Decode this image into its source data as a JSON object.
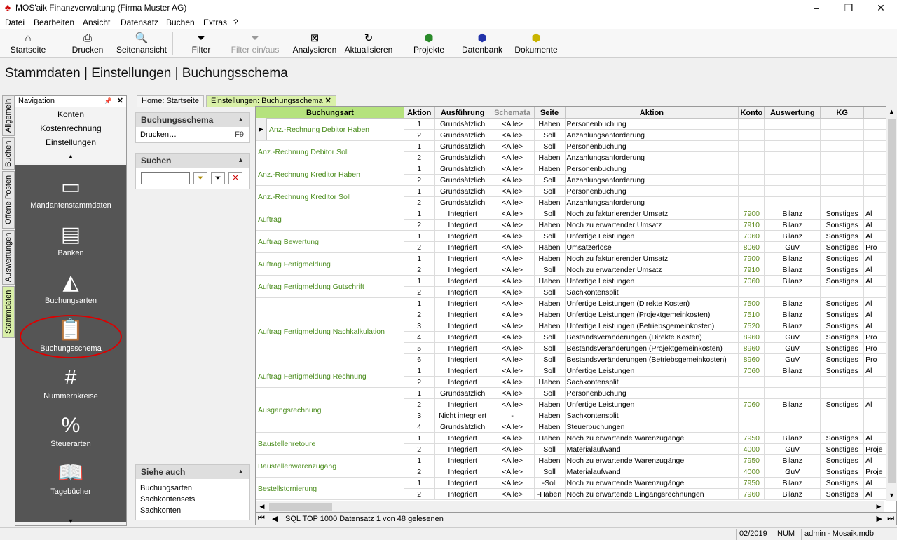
{
  "window": {
    "title": "MOS'aik Finanzverwaltung (Firma Muster AG)",
    "min": "–",
    "max": "❐",
    "close": "✕"
  },
  "menu": [
    "Datei",
    "Bearbeiten",
    "Ansicht",
    "Datensatz",
    "Buchen",
    "Extras",
    "?"
  ],
  "toolbar": {
    "startseite": "Startseite",
    "drucken": "Drucken",
    "seitenansicht": "Seitenansicht",
    "filter": "Filter",
    "filter_einaus": "Filter ein/aus",
    "analysieren": "Analysieren",
    "aktualisieren": "Aktualisieren",
    "projekte": "Projekte",
    "datenbank": "Datenbank",
    "dokumente": "Dokumente"
  },
  "page_title": "Stammdaten | Einstellungen | Buchungsschema",
  "vtabs": [
    "Allgemein",
    "Buchen",
    "Offene Posten",
    "Auswertungen",
    "Stammdaten"
  ],
  "navigation": {
    "title": "Navigation",
    "pin": "📌",
    "close": "✕",
    "buttons": [
      "Konten",
      "Kostenrechnung",
      "Einstellungen"
    ],
    "up": "▲",
    "down": "▼",
    "items": [
      "Mandantenstammdaten",
      "Banken",
      "Buchungsarten",
      "Buchungsschema",
      "Nummernkreise",
      "Steuerarten",
      "Tagebücher"
    ]
  },
  "panels": {
    "buchungsschema": {
      "title": "Buchungsschema",
      "item": "Drucken…",
      "shortcut": "F9"
    },
    "suchen": {
      "title": "Suchen",
      "value": ""
    },
    "siehe_auch": {
      "title": "Siehe auch",
      "items": [
        "Buchungsarten",
        "Sachkontensets",
        "Sachkonten"
      ]
    }
  },
  "tabs": {
    "home": "Home: Startseite",
    "einstellungen": "Einstellungen: Buchungsschema",
    "close": "✕"
  },
  "columns": [
    "Buchungsart",
    "Aktion",
    "Ausführung",
    "Schemata",
    "Seite",
    "Aktion",
    "Konto",
    "Auswertung",
    "KG",
    ""
  ],
  "groups": [
    {
      "name": "Anz.-Rechnung Debitor Haben",
      "rows": [
        [
          "1",
          "Grundsätzlich",
          "<Alle>",
          "Haben",
          "Personenbuchung",
          "",
          "",
          "",
          ""
        ],
        [
          "2",
          "Grundsätzlich",
          "<Alle>",
          "Soll",
          "Anzahlungsanforderung",
          "",
          "",
          "",
          ""
        ]
      ]
    },
    {
      "name": "Anz.-Rechnung Debitor Soll",
      "rows": [
        [
          "1",
          "Grundsätzlich",
          "<Alle>",
          "Soll",
          "Personenbuchung",
          "",
          "",
          "",
          ""
        ],
        [
          "2",
          "Grundsätzlich",
          "<Alle>",
          "Haben",
          "Anzahlungsanforderung",
          "",
          "",
          "",
          ""
        ]
      ]
    },
    {
      "name": "Anz.-Rechnung Kreditor Haben",
      "rows": [
        [
          "1",
          "Grundsätzlich",
          "<Alle>",
          "Haben",
          "Personenbuchung",
          "",
          "",
          "",
          ""
        ],
        [
          "2",
          "Grundsätzlich",
          "<Alle>",
          "Soll",
          "Anzahlungsanforderung",
          "",
          "",
          "",
          ""
        ]
      ]
    },
    {
      "name": "Anz.-Rechnung Kreditor Soll",
      "rows": [
        [
          "1",
          "Grundsätzlich",
          "<Alle>",
          "Soll",
          "Personenbuchung",
          "",
          "",
          "",
          ""
        ],
        [
          "2",
          "Grundsätzlich",
          "<Alle>",
          "Haben",
          "Anzahlungsanforderung",
          "",
          "",
          "",
          ""
        ]
      ]
    },
    {
      "name": "Auftrag",
      "rows": [
        [
          "1",
          "Integriert",
          "<Alle>",
          "Soll",
          "Noch zu fakturierender Umsatz",
          "7900",
          "Bilanz",
          "Sonstiges",
          "Al"
        ],
        [
          "2",
          "Integriert",
          "<Alle>",
          "Haben",
          "Noch zu erwartender Umsatz",
          "7910",
          "Bilanz",
          "Sonstiges",
          "Al"
        ]
      ]
    },
    {
      "name": "Auftrag Bewertung",
      "rows": [
        [
          "1",
          "Integriert",
          "<Alle>",
          "Soll",
          "Unfertige Leistungen",
          "7060",
          "Bilanz",
          "Sonstiges",
          "Al"
        ],
        [
          "2",
          "Integriert",
          "<Alle>",
          "Haben",
          "Umsatzerlöse",
          "8060",
          "GuV",
          "Sonstiges",
          "Pro"
        ]
      ]
    },
    {
      "name": "Auftrag Fertigmeldung",
      "rows": [
        [
          "1",
          "Integriert",
          "<Alle>",
          "Haben",
          "Noch zu fakturierender Umsatz",
          "7900",
          "Bilanz",
          "Sonstiges",
          "Al"
        ],
        [
          "2",
          "Integriert",
          "<Alle>",
          "Soll",
          "Noch zu erwartender Umsatz",
          "7910",
          "Bilanz",
          "Sonstiges",
          "Al"
        ]
      ]
    },
    {
      "name": "Auftrag Fertigmeldung Gutschrift",
      "rows": [
        [
          "1",
          "Integriert",
          "<Alle>",
          "Haben",
          "Unfertige Leistungen",
          "7060",
          "Bilanz",
          "Sonstiges",
          "Al"
        ],
        [
          "2",
          "Integriert",
          "<Alle>",
          "Soll",
          "Sachkontensplit",
          "",
          "",
          "",
          ""
        ]
      ]
    },
    {
      "name": "Auftrag Fertigmeldung Nachkalkulation",
      "rows": [
        [
          "1",
          "Integriert",
          "<Alle>",
          "Haben",
          "Unfertige Leistungen (Direkte Kosten)",
          "7500",
          "Bilanz",
          "Sonstiges",
          "Al"
        ],
        [
          "2",
          "Integriert",
          "<Alle>",
          "Haben",
          "Unfertige Leistungen (Projektgemeinkosten)",
          "7510",
          "Bilanz",
          "Sonstiges",
          "Al"
        ],
        [
          "3",
          "Integriert",
          "<Alle>",
          "Haben",
          "Unfertige Leistungen (Betriebsgemeinkosten)",
          "7520",
          "Bilanz",
          "Sonstiges",
          "Al"
        ],
        [
          "4",
          "Integriert",
          "<Alle>",
          "Soll",
          "Bestandsveränderungen (Direkte Kosten)",
          "8960",
          "GuV",
          "Sonstiges",
          "Pro"
        ],
        [
          "5",
          "Integriert",
          "<Alle>",
          "Soll",
          "Bestandsveränderungen (Projektgemeinkosten)",
          "8960",
          "GuV",
          "Sonstiges",
          "Pro"
        ],
        [
          "6",
          "Integriert",
          "<Alle>",
          "Soll",
          "Bestandsveränderungen (Betriebsgemeinkosten)",
          "8960",
          "GuV",
          "Sonstiges",
          "Pro"
        ]
      ]
    },
    {
      "name": "Auftrag Fertigmeldung Rechnung",
      "rows": [
        [
          "1",
          "Integriert",
          "<Alle>",
          "Soll",
          "Unfertige Leistungen",
          "7060",
          "Bilanz",
          "Sonstiges",
          "Al"
        ],
        [
          "2",
          "Integriert",
          "<Alle>",
          "Haben",
          "Sachkontensplit",
          "",
          "",
          "",
          ""
        ]
      ]
    },
    {
      "name": "Ausgangsrechnung",
      "rows": [
        [
          "1",
          "Grundsätzlich",
          "<Alle>",
          "Soll",
          "Personenbuchung",
          "",
          "",
          "",
          ""
        ],
        [
          "2",
          "Integriert",
          "<Alle>",
          "Haben",
          "Unfertige Leistungen",
          "7060",
          "Bilanz",
          "Sonstiges",
          "Al"
        ],
        [
          "3",
          "Nicht integriert",
          "-",
          "Haben",
          "Sachkontensplit",
          "",
          "",
          "",
          ""
        ],
        [
          "4",
          "Grundsätzlich",
          "<Alle>",
          "Haben",
          "Steuerbuchungen",
          "",
          "",
          "",
          ""
        ]
      ]
    },
    {
      "name": "Baustellenretoure",
      "rows": [
        [
          "1",
          "Integriert",
          "<Alle>",
          "Haben",
          "Noch zu erwartende Warenzugänge",
          "7950",
          "Bilanz",
          "Sonstiges",
          "Al"
        ],
        [
          "2",
          "Integriert",
          "<Alle>",
          "Soll",
          "Materialaufwand",
          "4000",
          "GuV",
          "Sonstiges",
          "Proje"
        ]
      ]
    },
    {
      "name": "Baustellenwarenzugang",
      "rows": [
        [
          "1",
          "Integriert",
          "<Alle>",
          "Haben",
          "Noch zu erwartende Warenzugänge",
          "7950",
          "Bilanz",
          "Sonstiges",
          "Al"
        ],
        [
          "2",
          "Integriert",
          "<Alle>",
          "Soll",
          "Materialaufwand",
          "4000",
          "GuV",
          "Sonstiges",
          "Proje"
        ]
      ]
    },
    {
      "name": "Bestellstornierung",
      "rows": [
        [
          "1",
          "Integriert",
          "<Alle>",
          "-Soll",
          "Noch zu erwartende Warenzugänge",
          "7950",
          "Bilanz",
          "Sonstiges",
          "Al"
        ],
        [
          "2",
          "Integriert",
          "<Alle>",
          "-Haben",
          "Noch zu erwartende Eingangsrechnungen",
          "7960",
          "Bilanz",
          "Sonstiges",
          "Al"
        ]
      ]
    }
  ],
  "recordbar": {
    "text": "SQL TOP 1000 Datensatz 1 von 48 gelesenen"
  },
  "statusbar": {
    "period": "02/2019",
    "num": "NUM",
    "user": "admin - Mosaik.mdb"
  }
}
